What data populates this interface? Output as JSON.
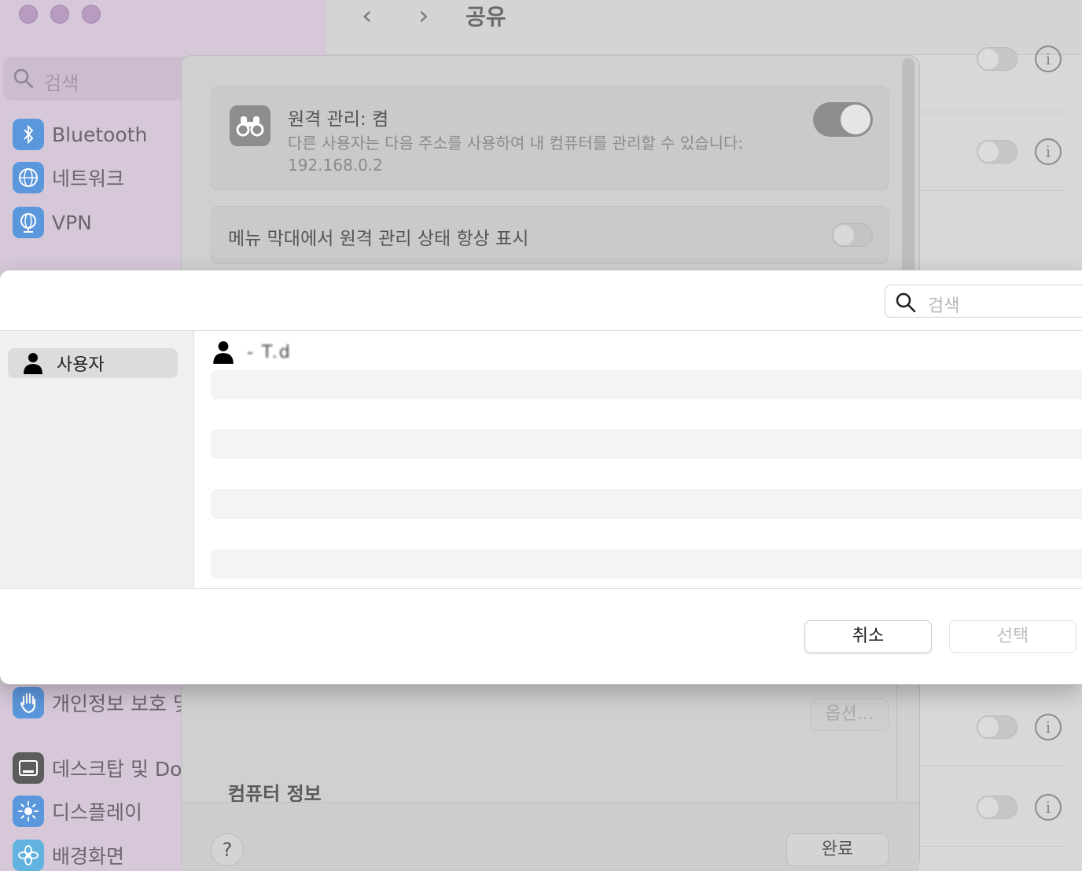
{
  "window": {
    "title": "공유",
    "back_glyph": "‹",
    "forward_glyph": "›"
  },
  "sidebar": {
    "search_placeholder": "검색",
    "items": [
      {
        "label": "Bluetooth",
        "icon": "bluetooth-icon",
        "color": "#4a8fe0"
      },
      {
        "label": "네트워크",
        "icon": "network-globe-icon",
        "color": "#4a8fe0"
      },
      {
        "label": "VPN",
        "icon": "vpn-globe-icon",
        "color": "#4a8fe0"
      },
      {
        "label": "개인정보 보호 및",
        "icon": "privacy-hand-icon",
        "color": "#4a8fe0"
      },
      {
        "label": "데스크탑 및 Do",
        "icon": "desktop-dock-icon",
        "color": "#555555"
      },
      {
        "label": "디스플레이",
        "icon": "display-sun-icon",
        "color": "#4a8fe0"
      },
      {
        "label": "배경화면",
        "icon": "wallpaper-flower-icon",
        "color": "#5ab0e0"
      }
    ]
  },
  "remote_sheet": {
    "title": "원격 관리: 켬",
    "description": "다른 사용자는 다음 주소를 사용하여 내 컴퓨터를 관리할 수 있습니다:",
    "address": "192.168.0.2",
    "toggle_on": true,
    "menu_bar_label": "메뉴 막대에서 원격 관리 상태 항상 표시",
    "menu_bar_toggle_on": false,
    "options_label": "옵션...",
    "computer_info_label": "컴퓨터 정보",
    "help_label": "?",
    "done_label": "완료"
  },
  "user_picker": {
    "search_placeholder": "검색",
    "categories": [
      {
        "label": "사용자",
        "icon": "person-icon",
        "selected": true
      }
    ],
    "users": [
      {
        "name": "- T.d",
        "icon": "person-icon"
      }
    ],
    "cancel_label": "취소",
    "select_label": "선택",
    "select_enabled": false
  }
}
